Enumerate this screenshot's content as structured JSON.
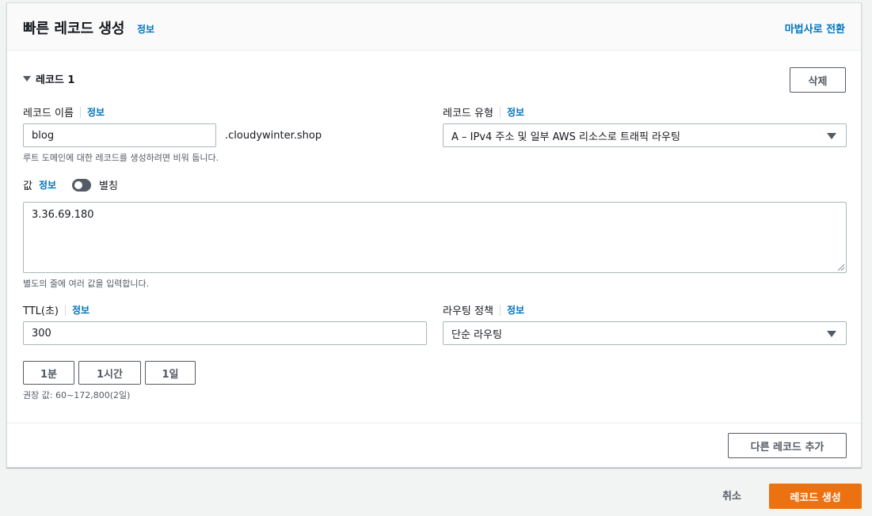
{
  "header": {
    "title": "빠른 레코드 생성",
    "info": "정보",
    "wizard_link": "마법사로 전환"
  },
  "record": {
    "toggle_label": "레코드 1",
    "delete_button": "삭제"
  },
  "record_name": {
    "label": "레코드 이름",
    "info": "정보",
    "value": "blog",
    "domain_suffix": ".cloudywinter.shop",
    "hint": "루트 도메인에 대한 레코드를 생성하려면 비워 둡니다."
  },
  "record_type": {
    "label": "레코드 유형",
    "info": "정보",
    "value": "A – IPv4 주소 및 일부 AWS 리소스로 트래픽 라우팅"
  },
  "value_field": {
    "label": "값",
    "info": "정보",
    "alias_label": "별칭",
    "alias_enabled": false,
    "value": "3.36.69.180",
    "hint": "별도의 줄에 여러 값을 입력합니다."
  },
  "ttl": {
    "label": "TTL(초)",
    "info": "정보",
    "value": "300",
    "preset_1m": "1분",
    "preset_1h": "1시간",
    "preset_1d": "1일",
    "hint": "권장 값: 60~172,800(2일)"
  },
  "routing_policy": {
    "label": "라우팅 정책",
    "info": "정보",
    "value": "단순 라우팅"
  },
  "add_record_button": "다른 레코드 추가",
  "footer": {
    "cancel": "취소",
    "create": "레코드 생성"
  },
  "colors": {
    "primary": "#ec7211",
    "link": "#0073bb",
    "toggle_off": "#545b64"
  }
}
